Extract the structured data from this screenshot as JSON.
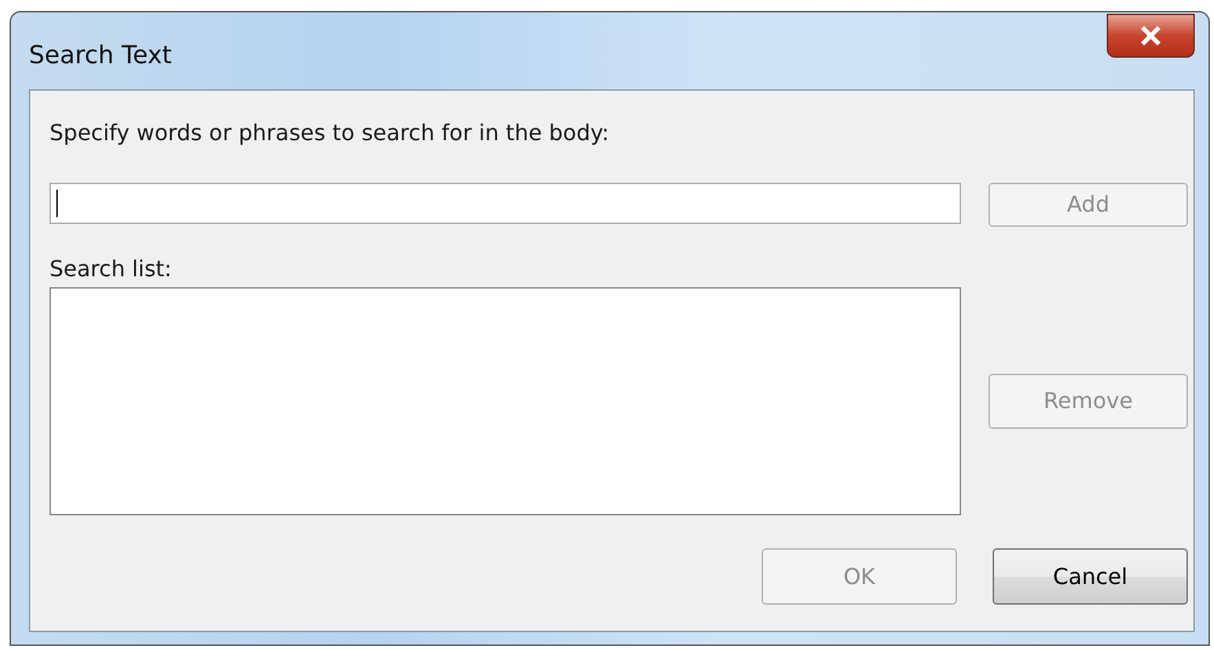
{
  "window": {
    "title": "Search Text"
  },
  "prompt": "Specify words or phrases to search for in the body:",
  "search_field": {
    "focused": true
  },
  "add_button": {
    "label": "Add",
    "disabled": true
  },
  "list_label": "Search list:",
  "remove_button": {
    "label": "Remove",
    "disabled": true
  },
  "footer_buttons": [
    {
      "label": "OK",
      "disabled": true
    },
    {
      "label": "Cancel",
      "disabled": false
    }
  ]
}
